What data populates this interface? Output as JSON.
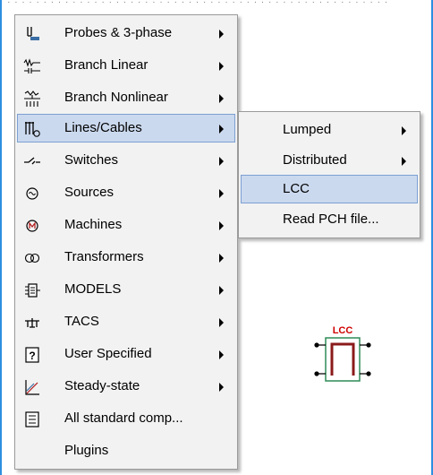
{
  "top_strip_text": "· · · · · · · · · · · · · · · · · · · · · · · · · · · · · · · · · · · · · · · · · · · · · · · · · · · · · ·",
  "main_menu": {
    "items": [
      {
        "label": "Probes & 3-phase",
        "icon": "probe-icon",
        "has_submenu": true
      },
      {
        "label": "Branch Linear",
        "icon": "branch-linear-icon",
        "has_submenu": true
      },
      {
        "label": "Branch Nonlinear",
        "icon": "branch-nonlinear-icon",
        "has_submenu": true
      },
      {
        "label": "Lines/Cables",
        "icon": "lines-cables-icon",
        "has_submenu": true,
        "highlighted": true
      },
      {
        "label": "Switches",
        "icon": "switch-icon",
        "has_submenu": true
      },
      {
        "label": "Sources",
        "icon": "source-icon",
        "has_submenu": true
      },
      {
        "label": "Machines",
        "icon": "machine-icon",
        "has_submenu": true
      },
      {
        "label": "Transformers",
        "icon": "transformer-icon",
        "has_submenu": true
      },
      {
        "label": "MODELS",
        "icon": "models-icon",
        "has_submenu": true
      },
      {
        "label": "TACS",
        "icon": "tacs-icon",
        "has_submenu": true
      },
      {
        "label": "User Specified",
        "icon": "user-specified-icon",
        "has_submenu": true
      },
      {
        "label": "Steady-state",
        "icon": "steady-state-icon",
        "has_submenu": true
      },
      {
        "label": "All standard comp...",
        "icon": "all-standard-icon",
        "has_submenu": false
      },
      {
        "label": "Plugins",
        "icon": "",
        "has_submenu": false
      }
    ]
  },
  "sub_menu": {
    "items": [
      {
        "label": "Lumped",
        "has_submenu": true
      },
      {
        "label": "Distributed",
        "has_submenu": true
      },
      {
        "label": "LCC",
        "has_submenu": false,
        "highlighted": true
      },
      {
        "label": "Read PCH file...",
        "has_submenu": false
      }
    ]
  },
  "component": {
    "label": "LCC",
    "label_color": "#d00000",
    "box_color": "#2e8b57",
    "line_color": "#8b1a1a"
  },
  "colors": {
    "highlight_bg": "#cbd9ee",
    "highlight_border": "#7d9fd3",
    "menu_bg": "#f2f2f2",
    "frame": "#2f8fe0"
  }
}
